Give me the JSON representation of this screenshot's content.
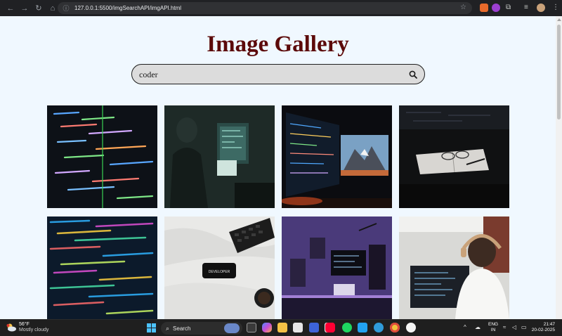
{
  "browser": {
    "url": "127.0.0.1:5500/imgSearchAPI/imgAPI.html"
  },
  "page": {
    "title": "Image Gallery",
    "search": {
      "value": "coder"
    }
  },
  "gallery": {
    "images": [
      {
        "subject": "code-on-monitor"
      },
      {
        "subject": "hooded-coder-dark-room"
      },
      {
        "subject": "dual-monitor-coding-setup"
      },
      {
        "subject": "notebook-and-glasses"
      },
      {
        "subject": "colorful-code-screen"
      },
      {
        "subject": "phone-with-developer-label",
        "label": "DEVELOPER"
      },
      {
        "subject": "purple-lit-desk-setup"
      },
      {
        "subject": "developer-with-headphones"
      }
    ]
  },
  "taskbar": {
    "weather": {
      "temperature": "56°F",
      "condition": "Mostly cloudy"
    },
    "search_label": "Search",
    "language": {
      "line1": "ENG",
      "line2": "IN"
    },
    "clock": {
      "time": "21:47",
      "date": "20-02-2025"
    }
  },
  "colors": {
    "page_bg": "#f0f8ff",
    "title": "#5c0a0a",
    "search_bg": "#dcdcdc"
  }
}
